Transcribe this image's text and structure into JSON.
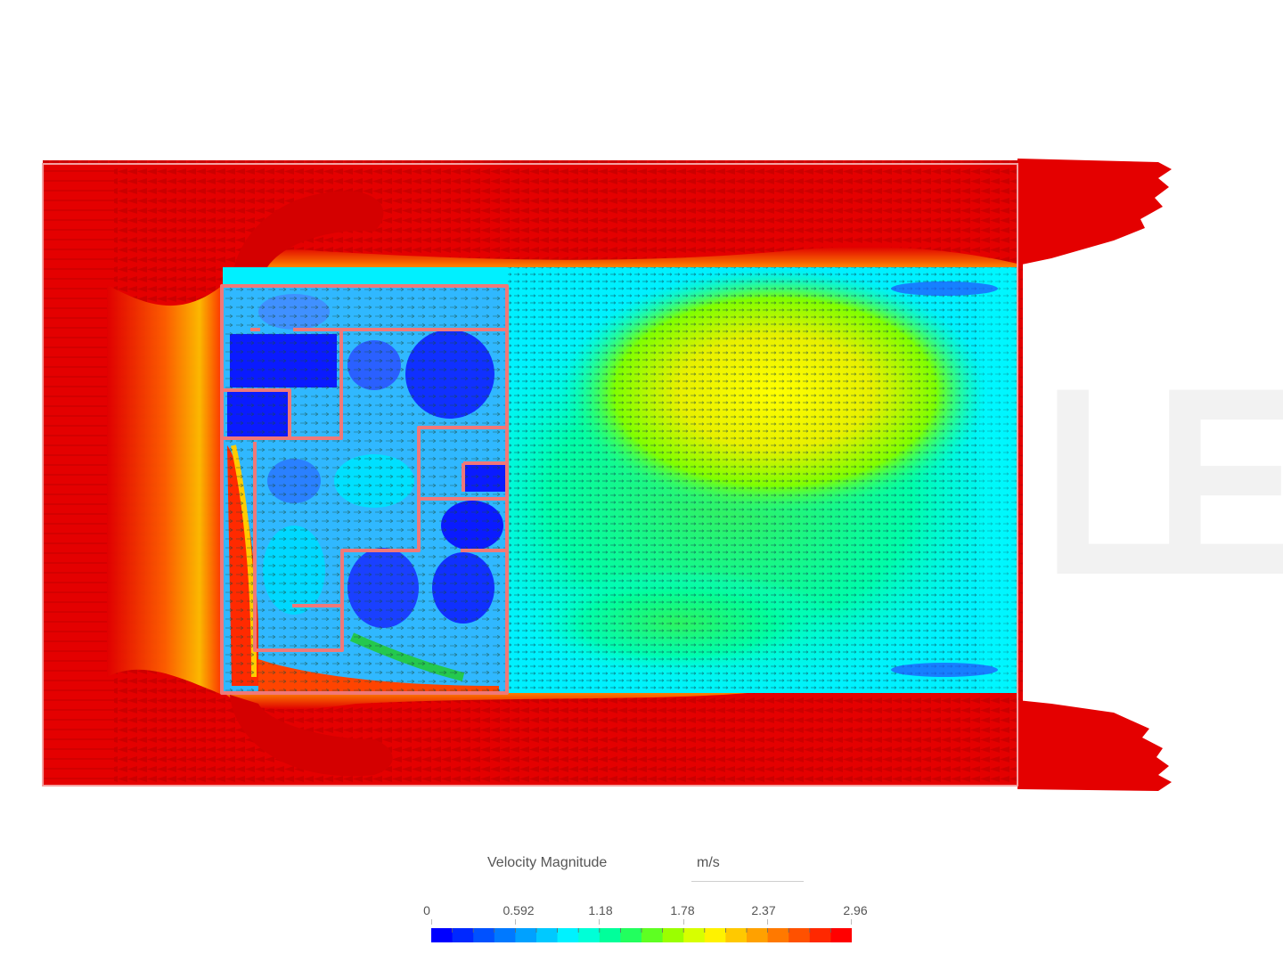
{
  "watermark": "LE",
  "legend": {
    "title": "Velocity Magnitude",
    "unit": "m/s",
    "ticks": [
      "0",
      "0.592",
      "1.18",
      "1.78",
      "2.37",
      "2.96"
    ],
    "min": 0,
    "max": 2.96,
    "colormap": [
      "#0000ff",
      "#0055ff",
      "#00aaff",
      "#00ffff",
      "#00ff80",
      "#80ff00",
      "#ffff00",
      "#ffaa00",
      "#ff5500",
      "#ff0000"
    ]
  },
  "colors": {
    "wall": "#f08080",
    "domain_border": "#f4a0a0",
    "high": "#e00000",
    "low": "#0000ff"
  }
}
